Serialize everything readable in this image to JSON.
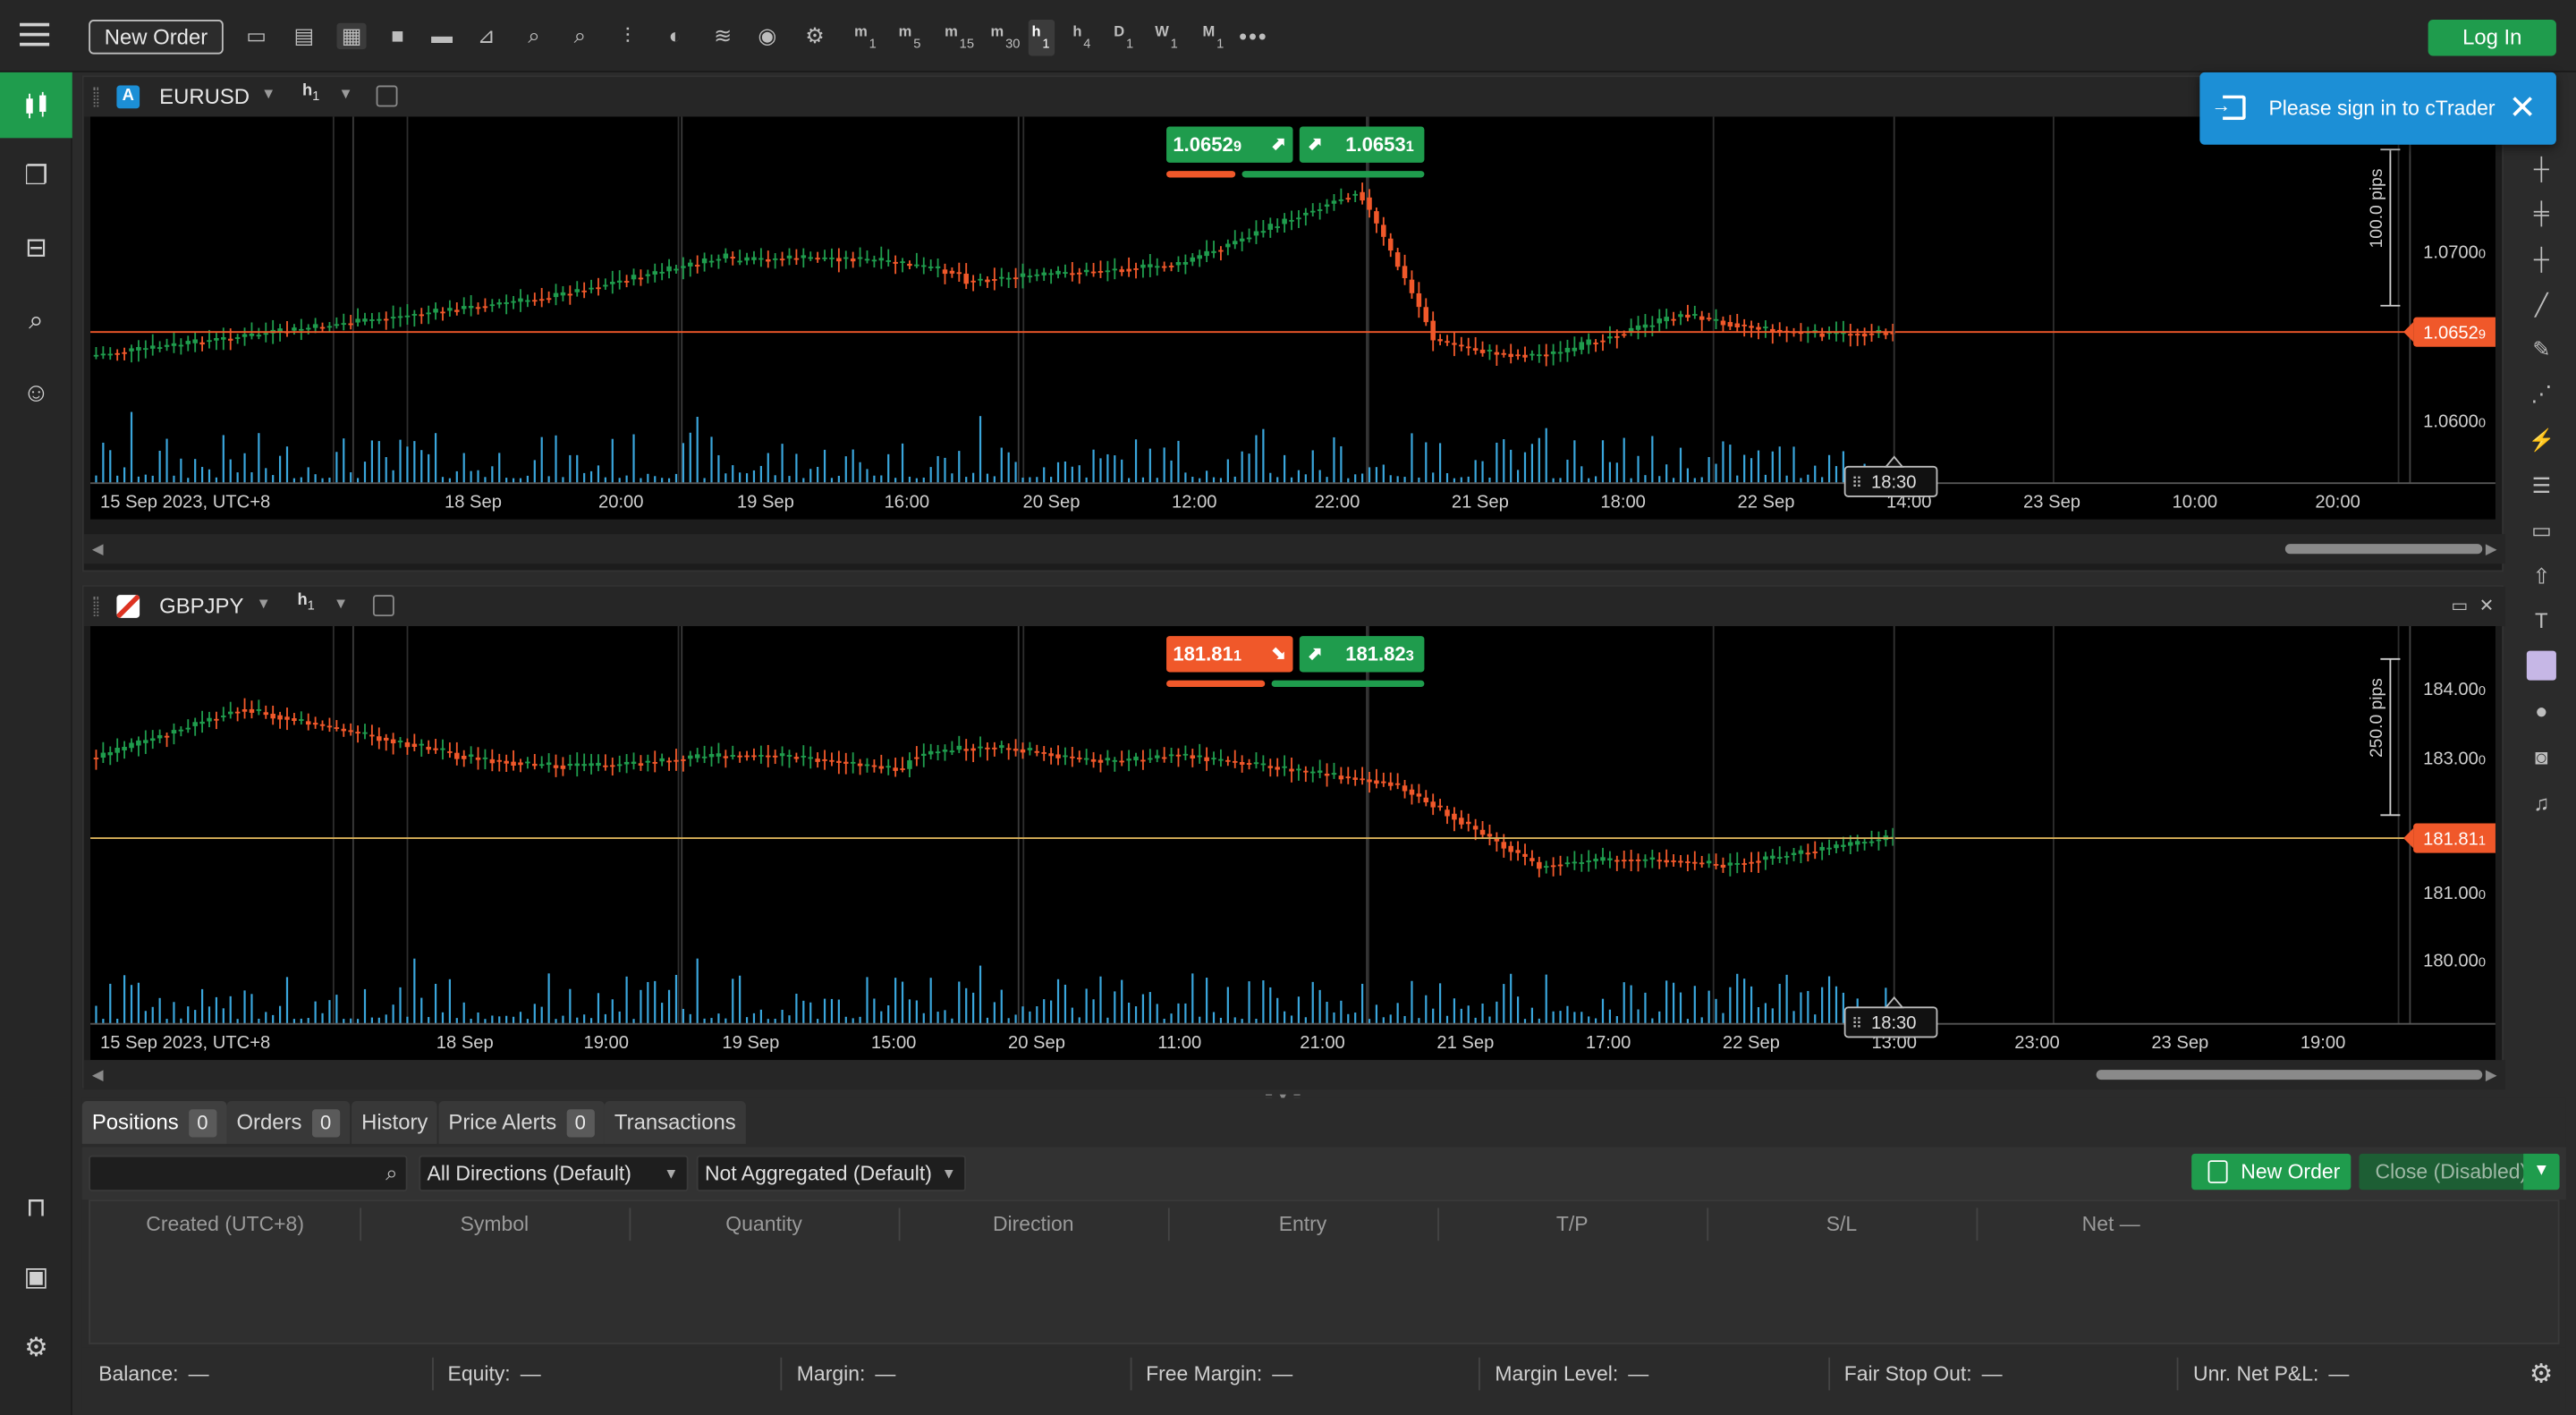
{
  "toolbar": {
    "new_order": "New Order",
    "timeframes": [
      {
        "l": "m",
        "s": "1"
      },
      {
        "l": "m",
        "s": "5"
      },
      {
        "l": "m",
        "s": "15"
      },
      {
        "l": "m",
        "s": "30"
      },
      {
        "l": "h",
        "s": "1"
      },
      {
        "l": "h",
        "s": "4"
      },
      {
        "l": "D",
        "s": "1"
      },
      {
        "l": "W",
        "s": "1"
      },
      {
        "l": "M",
        "s": "1"
      }
    ],
    "login": "Log In"
  },
  "notification": {
    "text": "Please sign in to cTrader"
  },
  "chart1": {
    "symbol": "EURUSD",
    "badge": "A",
    "timeframe": "h",
    "timeframe_sub": "1",
    "sell_price": "1.0652",
    "sell_price_small": "9",
    "buy_price": "1.0653",
    "buy_price_small": "1",
    "current_price": "1.0652",
    "current_price_small": "9",
    "pips_label": "100.0 pips",
    "y_ticks": [
      "1.0700",
      "1.0600"
    ],
    "y_tick_smalls": [
      "0",
      "0"
    ],
    "x_ticks": [
      "15 Sep 2023, UTC+8",
      "18 Sep",
      "20:00",
      "19 Sep",
      "16:00",
      "20 Sep",
      "12:00",
      "22:00",
      "21 Sep",
      "18:00",
      "22 Sep",
      "14:00",
      "23 Sep",
      "10:00",
      "20:00"
    ],
    "cursor_time": "18:30"
  },
  "chart2": {
    "symbol": "GBPJPY",
    "badge": "",
    "timeframe": "h",
    "timeframe_sub": "1",
    "sell_price": "181.81",
    "sell_price_small": "1",
    "buy_price": "181.82",
    "buy_price_small": "3",
    "current_price": "181.81",
    "current_price_small": "1",
    "pips_label": "250.0 pips",
    "y_ticks": [
      "184.00",
      "183.00",
      "181.00",
      "180.00"
    ],
    "y_tick_smalls": [
      "0",
      "0",
      "0",
      "0"
    ],
    "x_ticks": [
      "15 Sep 2023, UTC+8",
      "18 Sep",
      "19:00",
      "19 Sep",
      "15:00",
      "20 Sep",
      "11:00",
      "21:00",
      "21 Sep",
      "17:00",
      "22 Sep",
      "13:00",
      "23:00",
      "23 Sep",
      "19:00"
    ],
    "cursor_time": "18:30"
  },
  "bottom": {
    "tabs": [
      {
        "label": "Positions",
        "count": "0"
      },
      {
        "label": "Orders",
        "count": "0"
      },
      {
        "label": "History",
        "count": ""
      },
      {
        "label": "Price Alerts",
        "count": "0"
      },
      {
        "label": "Transactions",
        "count": ""
      }
    ],
    "search_placeholder": "",
    "direction_filter": "All Directions (Default)",
    "aggregation_filter": "Not Aggregated (Default)",
    "new_order": "New Order",
    "close": "Close (Disabled)",
    "columns": [
      "Created (UTC+8)",
      "Symbol",
      "Quantity",
      "Direction",
      "Entry",
      "T/P",
      "S/L",
      "Net —"
    ],
    "stats": [
      {
        "label": "Balance:",
        "value": "—"
      },
      {
        "label": "Equity:",
        "value": "—"
      },
      {
        "label": "Margin:",
        "value": "—"
      },
      {
        "label": "Free Margin:",
        "value": "—"
      },
      {
        "label": "Margin Level:",
        "value": "—"
      },
      {
        "label": "Fair Stop Out:",
        "value": "—"
      },
      {
        "label": "Unr. Net P&L:",
        "value": "—"
      }
    ]
  },
  "colors": {
    "bull": "#1f9c4d",
    "bear": "#f0582a",
    "volume": "#3aa6dc",
    "accent": "#1f9c4d",
    "notify": "#1c8fd6"
  },
  "icons": [
    "menu-icon",
    "chart-icon",
    "copy-icon",
    "robot-icon",
    "analyze-icon",
    "people-icon",
    "gear-icon",
    "bell-icon",
    "camera-icon"
  ]
}
